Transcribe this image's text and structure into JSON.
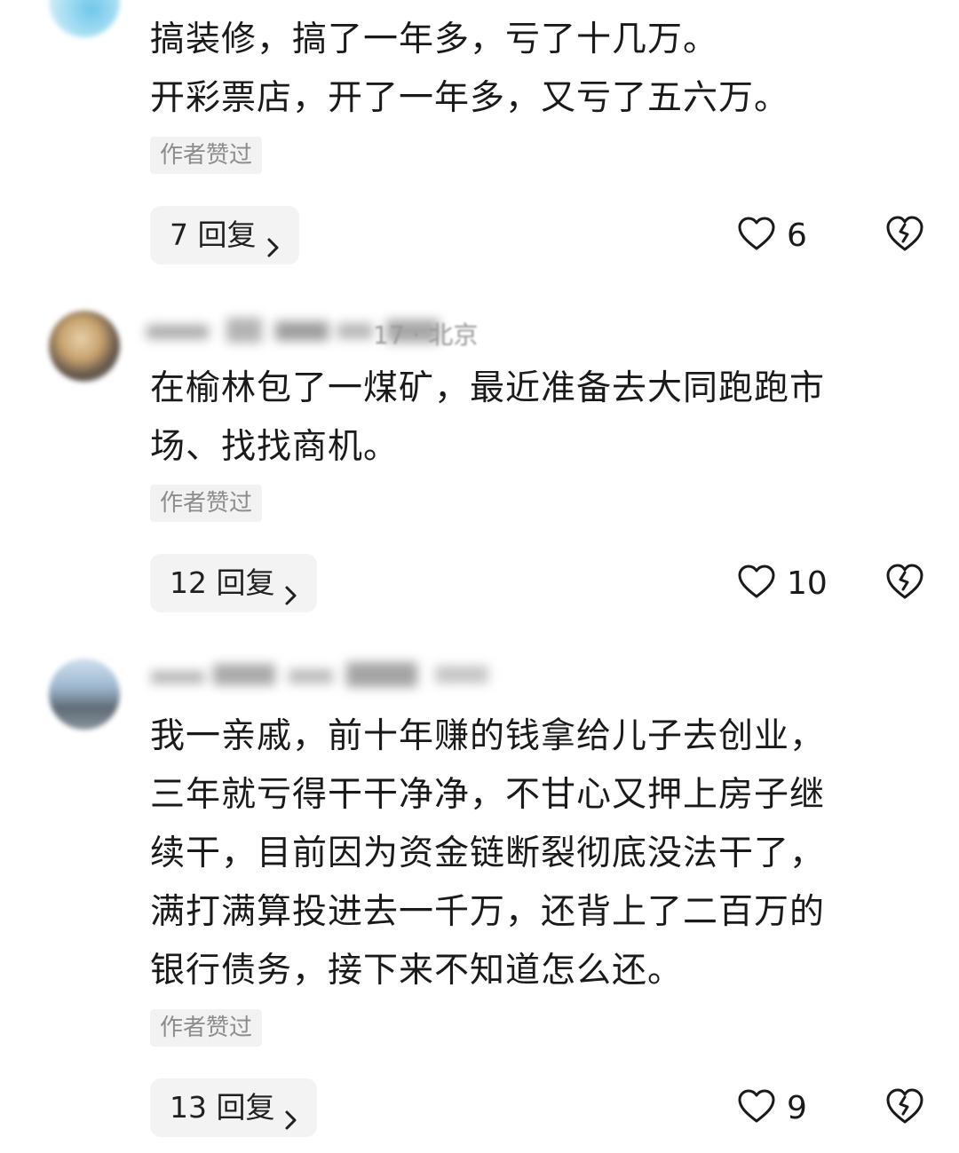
{
  "comments": [
    {
      "author_blurred": "",
      "meta_blurred": "",
      "lines": [
        "搞装修，搞了一年多，亏了十几万。",
        "开彩票店，开了一年多，又亏了五六万。"
      ],
      "badge": "作者赞过",
      "reply_label": "7 回复",
      "like_count": "6"
    },
    {
      "author_blurred": "",
      "meta_blurred": "17 · 北京",
      "lines": [
        "在榆林包了一煤矿，最近准备去大同跑跑市",
        "场、找找商机。"
      ],
      "badge": "作者赞过",
      "reply_label": "12 回复",
      "like_count": "10"
    },
    {
      "author_blurred": "",
      "meta_blurred": "",
      "lines": [
        "我一亲戚，前十年赚的钱拿给儿子去创业，",
        "三年就亏得干干净净，不甘心又押上房子继",
        "续干，目前因为资金链断裂彻底没法干了，",
        "满打满算投进去一千万，还背上了二百万的",
        "银行债务，接下来不知道怎么还。"
      ],
      "badge": "作者赞过",
      "reply_label": "13 回复",
      "like_count": "9"
    }
  ],
  "icons": {
    "like": "heart-outline-icon",
    "dislike": "broken-heart-icon",
    "reply_chevron": "chevron-right-icon"
  },
  "colors": {
    "text": "#1a1a1a",
    "badge_bg": "#f2f2f2",
    "badge_text": "#8c8c8c",
    "reply_bg": "#f3f3f3"
  }
}
